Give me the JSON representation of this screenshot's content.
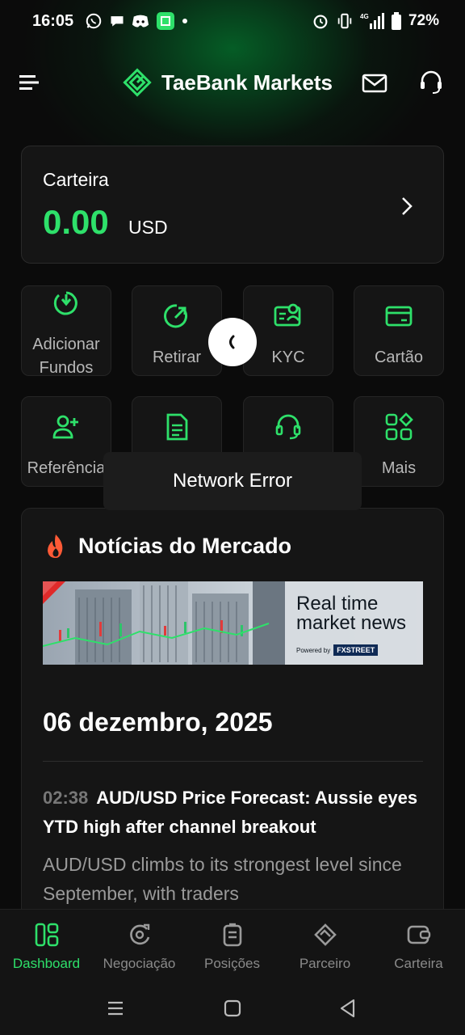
{
  "status_bar": {
    "time": "16:05",
    "battery": "72%",
    "network": "4G"
  },
  "header": {
    "brand": "TaeBank Markets"
  },
  "wallet": {
    "title": "Carteira",
    "amount": "0.00",
    "currency": "USD"
  },
  "actions": [
    {
      "label": "Adicionar Fundos",
      "icon": "add-funds-icon"
    },
    {
      "label": "Retirar",
      "icon": "withdraw-icon"
    },
    {
      "label": "KYC",
      "icon": "kyc-icon"
    },
    {
      "label": "Cartão",
      "icon": "card-icon"
    },
    {
      "label": "Referência",
      "icon": "referral-icon"
    },
    {
      "label": "",
      "icon": "document-icon"
    },
    {
      "label": "",
      "icon": "support-headset-icon"
    },
    {
      "label": "Mais",
      "icon": "more-grid-icon"
    }
  ],
  "news": {
    "title": "Notícias do Mercado",
    "banner": {
      "line1": "Real time",
      "line2": "market news",
      "powered_by": "Powered by",
      "source": "FXSTREET"
    },
    "date": "06 dezembro, 2025",
    "items": [
      {
        "time": "02:38",
        "headline": "AUD/USD Price Forecast: Aussie eyes YTD high after channel breakout",
        "summary": "AUD/USD climbs to its strongest level since September, with traders"
      }
    ]
  },
  "toast": {
    "message": "Network Error"
  },
  "bottom_nav": [
    {
      "label": "Dashboard",
      "active": true
    },
    {
      "label": "Negociação",
      "active": false
    },
    {
      "label": "Posições",
      "active": false
    },
    {
      "label": "Parceiro",
      "active": false
    },
    {
      "label": "Carteira",
      "active": false
    }
  ],
  "colors": {
    "accent": "#2ee06a",
    "background": "#0b0b0b",
    "card": "#151515"
  }
}
